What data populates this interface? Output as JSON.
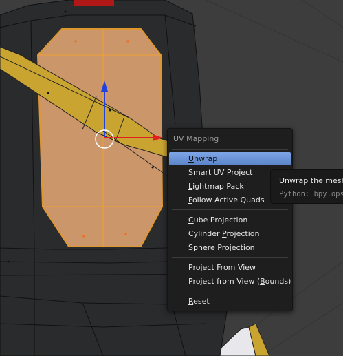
{
  "menu": {
    "title": "UV Mapping",
    "items": [
      {
        "pre": "",
        "u": "U",
        "post": "nwrap",
        "active": true
      },
      {
        "pre": "",
        "u": "S",
        "post": "mart UV Project"
      },
      {
        "pre": "",
        "u": "L",
        "post": "ightmap Pack"
      },
      {
        "pre": "",
        "u": "F",
        "post": "ollow Active Quads"
      },
      {
        "pre": "",
        "u": "C",
        "post": "ube Projection"
      },
      {
        "pre": "Cylinder ",
        "u": "P",
        "post": "rojection"
      },
      {
        "pre": "Sp",
        "u": "h",
        "post": "ere Projection"
      },
      {
        "pre": "Project From ",
        "u": "V",
        "post": "iew"
      },
      {
        "pre": "Project from View (",
        "u": "B",
        "post": "ounds)"
      },
      {
        "pre": "",
        "u": "R",
        "post": "eset"
      }
    ]
  },
  "tooltip": {
    "title": "Unwrap the mesh o",
    "python": "Python: bpy.ops."
  },
  "colors": {
    "background": "#3b3b3b",
    "mesh_dark": "#2a2b2d",
    "selected_face": "#d9a070",
    "selected_edge": "#f0a030",
    "yellow_strip": "#c9a431",
    "axis_x": "#e02020",
    "axis_z": "#2040e0",
    "menu_highlight": "#6d94d8"
  }
}
